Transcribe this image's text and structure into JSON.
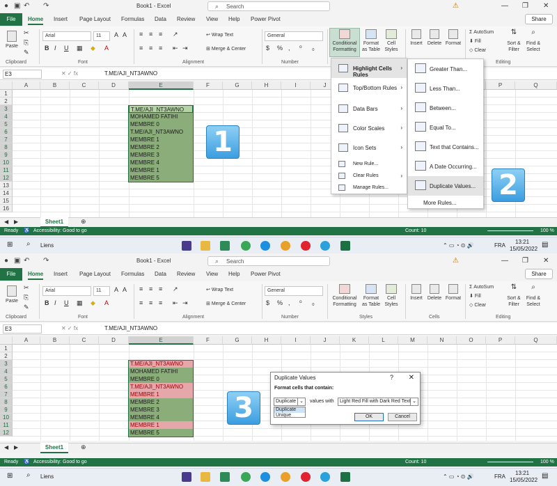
{
  "app": {
    "title": "Book1 - Excel",
    "search_placeholder": "Search",
    "share_label": "Share",
    "tabs": [
      "File",
      "Home",
      "Insert",
      "Page Layout",
      "Formulas",
      "Data",
      "Review",
      "View",
      "Help",
      "Power Pivot"
    ],
    "active_tab": "Home"
  },
  "ribbon": {
    "clipboard": {
      "paste": "Paste",
      "label": "Clipboard"
    },
    "font": {
      "name": "Arial",
      "size": "11",
      "label": "Font"
    },
    "alignment": {
      "wrap": "Wrap Text",
      "merge": "Merge & Center",
      "label": "Alignment"
    },
    "number": {
      "format": "General",
      "label": "Number"
    },
    "styles": {
      "cf": "Conditional Formatting",
      "fat": "Format as Table",
      "cs": "Cell Styles",
      "label": "Styles"
    },
    "cells": {
      "insert": "Insert",
      "delete": "Delete",
      "format": "Format",
      "label": "Cells"
    },
    "editing": {
      "autosum": "AutoSum",
      "fill": "Fill",
      "clear": "Clear",
      "sort": "Sort & Filter",
      "find": "Find & Select",
      "label": "Editing"
    }
  },
  "formula_bar": {
    "name_box": "E3",
    "value": "T.ME/AJI_NT3AWNO"
  },
  "grid": {
    "columns": [
      "A",
      "B",
      "C",
      "D",
      "E",
      "F",
      "G",
      "H",
      "I",
      "J",
      "K",
      "L",
      "M",
      "N",
      "O",
      "P",
      "Q"
    ],
    "rows": [
      "1",
      "2",
      "3",
      "4",
      "5",
      "6",
      "7",
      "8",
      "9",
      "10",
      "11",
      "12",
      "13",
      "14",
      "15",
      "16"
    ],
    "cells": [
      "T.ME/AJI_NT3AWNO",
      "MOHAMED FATIHI",
      "MEMBRE 0",
      "T.ME/AJI_NT3AWNO",
      "MEMBRE 1",
      "MEMBRE 2",
      "MEMBRE 3",
      "MEMBRE 4",
      "MEMBRE 1",
      "MEMBRE 5"
    ]
  },
  "sheet_tab": "Sheet1",
  "status": {
    "ready": "Ready",
    "accessibility": "Accessibility: Good to go",
    "count": "Count: 10",
    "zoom": "100 %"
  },
  "cf_menu": [
    {
      "label": "Highlight Cells Rules",
      "arrow": true
    },
    {
      "label": "Top/Bottom Rules",
      "arrow": true
    },
    {
      "label": "Data Bars",
      "arrow": true
    },
    {
      "label": "Color Scales",
      "arrow": true
    },
    {
      "label": "Icon Sets",
      "arrow": true
    },
    {
      "label": "New Rule..."
    },
    {
      "label": "Clear Rules",
      "arrow": true
    },
    {
      "label": "Manage Rules..."
    }
  ],
  "hcr_menu": [
    "Greater Than...",
    "Less Than...",
    "Between...",
    "Equal To...",
    "Text that Contains...",
    "A Date Occurring...",
    "Duplicate Values...",
    "More Rules..."
  ],
  "dialog": {
    "title": "Duplicate Values",
    "help": "?",
    "label": "Format cells that contain:",
    "selected": "Duplicate",
    "options": [
      "Duplicate",
      "Unique"
    ],
    "values_with": "values with",
    "format": "Light Red Fill with Dark Red Text",
    "ok": "OK",
    "cancel": "Cancel"
  },
  "badges": [
    "1",
    "2",
    "3"
  ],
  "taskbar": {
    "search": "Liens",
    "lang": "FRA",
    "time": "13:21",
    "date": "15/05/2022"
  }
}
